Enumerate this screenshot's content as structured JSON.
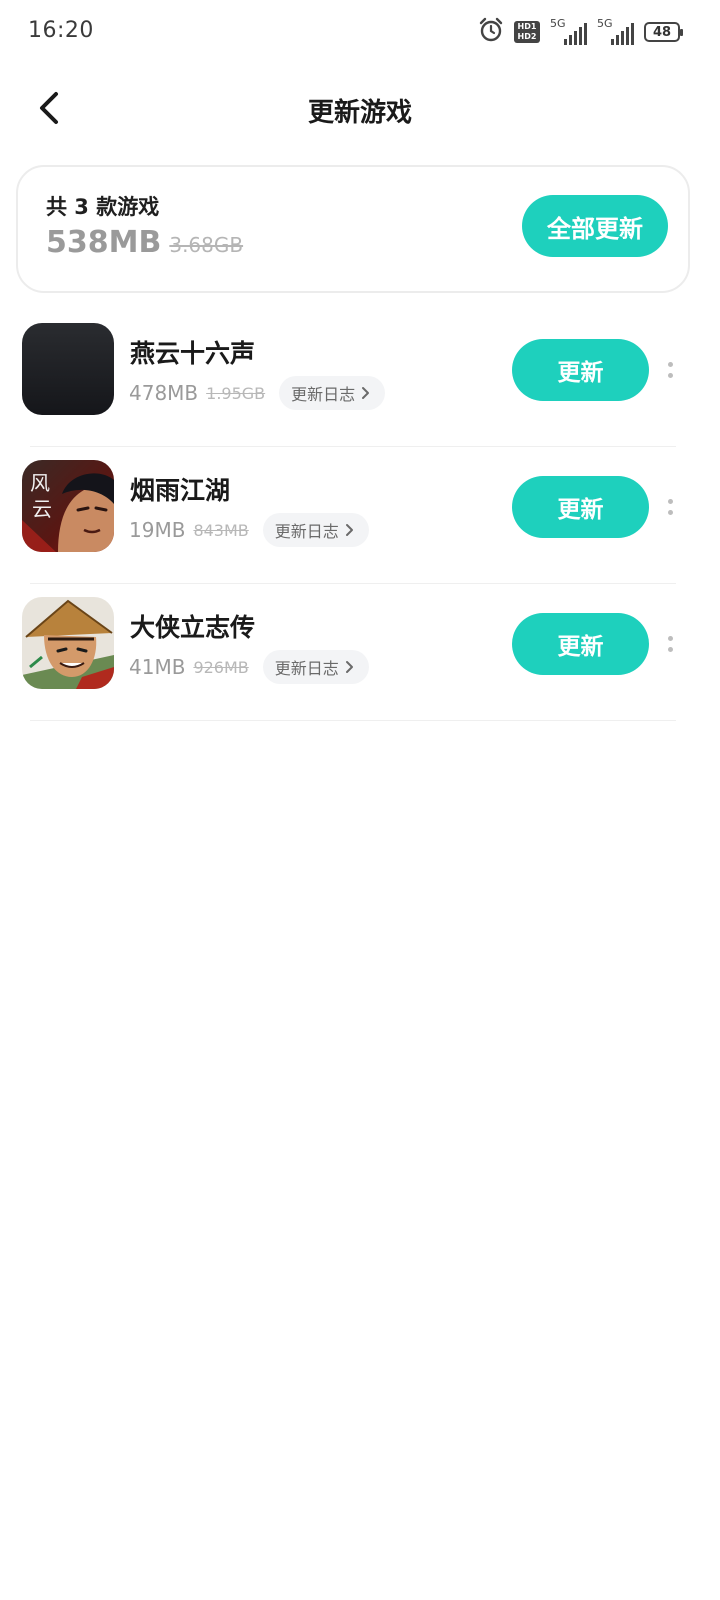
{
  "status_bar": {
    "time": "16:20",
    "alarm_icon": "alarm-clock-icon",
    "hd_badge": [
      "HD1",
      "HD2"
    ],
    "signal_1_label": "5G",
    "signal_2_label": "5G",
    "battery": "48"
  },
  "header": {
    "title": "更新游戏",
    "back_icon": "chevron-left-icon"
  },
  "summary": {
    "count_text": "共 3 款游戏",
    "size_current": "538MB",
    "size_original": "3.68GB",
    "update_all_label": "全部更新"
  },
  "games": [
    {
      "name": "燕云十六声",
      "size_current": "478MB",
      "size_original": "1.95GB",
      "changelog_label": "更新日志",
      "update_label": "更新",
      "icon": "yanyun-game-icon"
    },
    {
      "name": "烟雨江湖",
      "size_current": "19MB",
      "size_original": "843MB",
      "changelog_label": "更新日志",
      "update_label": "更新",
      "icon": "yanyu-game-icon"
    },
    {
      "name": "大侠立志传",
      "size_current": "41MB",
      "size_original": "926MB",
      "changelog_label": "更新日志",
      "update_label": "更新",
      "icon": "daxia-game-icon"
    }
  ],
  "colors": {
    "accent": "#1ed0bd",
    "text_primary": "#1a1a1a",
    "text_secondary": "#9a9a9a",
    "chip_bg": "#f3f4f6"
  }
}
